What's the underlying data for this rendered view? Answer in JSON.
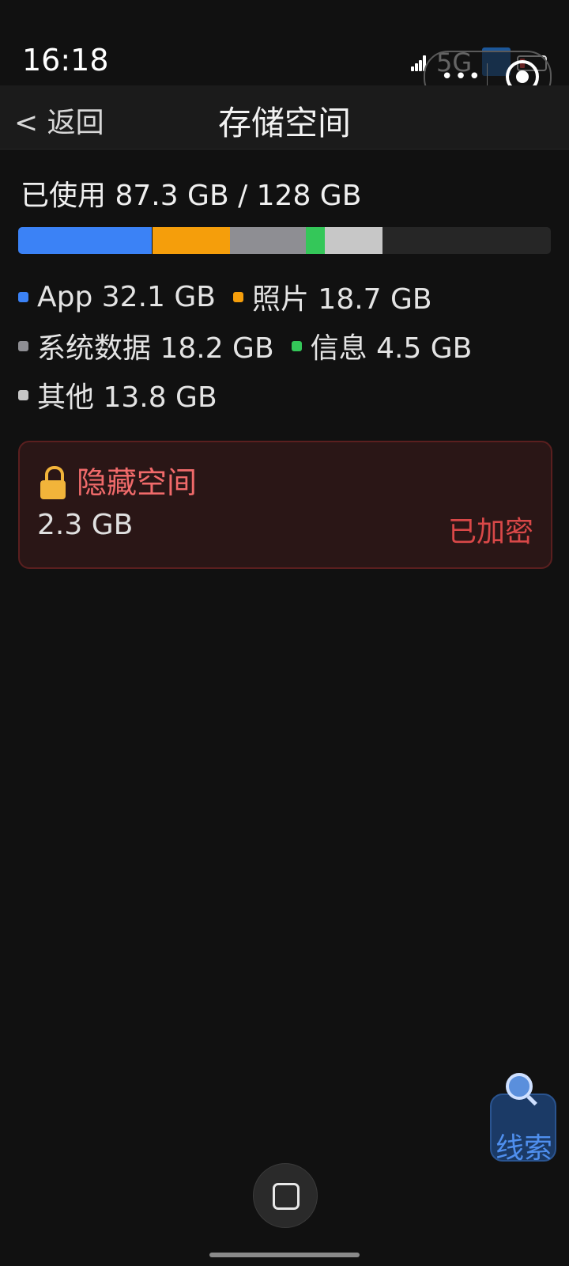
{
  "status_bar": {
    "time": "16:18",
    "network": "5G",
    "battery_color": "#e03a3a"
  },
  "nav": {
    "back_label": "< 返回",
    "title": "存储空间"
  },
  "storage": {
    "used_label": "已使用 87.3 GB / 128 GB",
    "used_gb": 87.3,
    "total_gb": 128,
    "categories": [
      {
        "label": "App 32.1 GB",
        "name": "App",
        "size_gb": 32.1,
        "color": "#3b82f6"
      },
      {
        "label": "照片 18.7 GB",
        "name": "照片",
        "size_gb": 18.7,
        "color": "#f59e0b"
      },
      {
        "label": "系统数据 18.2 GB",
        "name": "系统数据",
        "size_gb": 18.2,
        "color": "#8e8e93"
      },
      {
        "label": "信息 4.5 GB",
        "name": "信息",
        "size_gb": 4.5,
        "color": "#34c759"
      },
      {
        "label": "其他 13.8 GB",
        "name": "其他",
        "size_gb": 13.8,
        "color": "#c7c7c7"
      }
    ]
  },
  "hidden_space": {
    "title": "隐藏空间",
    "size": "2.3 GB",
    "status": "已加密",
    "lock_icon": "lock-icon"
  },
  "floating": {
    "clue_label": "线索",
    "icon": "magnifier-icon"
  }
}
